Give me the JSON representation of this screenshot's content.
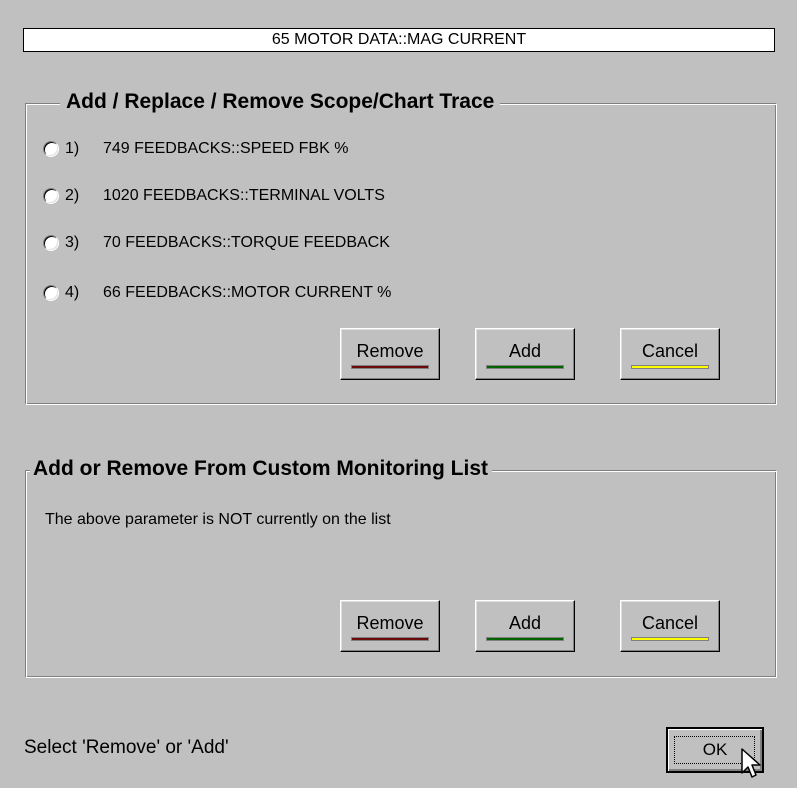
{
  "header": {
    "parameter_title": "65   MOTOR DATA::MAG CURRENT"
  },
  "trace_section": {
    "legend": "Add / Replace / Remove  Scope/Chart Trace",
    "options": [
      {
        "number": "1)",
        "text": "749  FEEDBACKS::SPEED FBK %"
      },
      {
        "number": "2)",
        "text": "1020  FEEDBACKS::TERMINAL VOLTS"
      },
      {
        "number": "3)",
        "text": "70  FEEDBACKS::TORQUE FEEDBACK"
      },
      {
        "number": "4)",
        "text": "66  FEEDBACKS::MOTOR CURRENT %"
      }
    ],
    "buttons": {
      "remove": "Remove",
      "add": "Add",
      "cancel": "Cancel"
    }
  },
  "monitoring_section": {
    "legend": "Add  or  Remove From Custom Monitoring List",
    "status_message": "The above parameter is NOT currently on the list",
    "buttons": {
      "remove": "Remove",
      "add": "Add",
      "cancel": "Cancel"
    }
  },
  "footer": {
    "status": "Select 'Remove' or 'Add'",
    "ok_label": "OK"
  },
  "colors": {
    "background": "#c0c0c0",
    "remove_indicator": "#6b0a0a",
    "add_indicator": "#006400",
    "cancel_indicator": "#ffff00"
  },
  "icons": {
    "cursor": "arrow-cursor-icon"
  }
}
